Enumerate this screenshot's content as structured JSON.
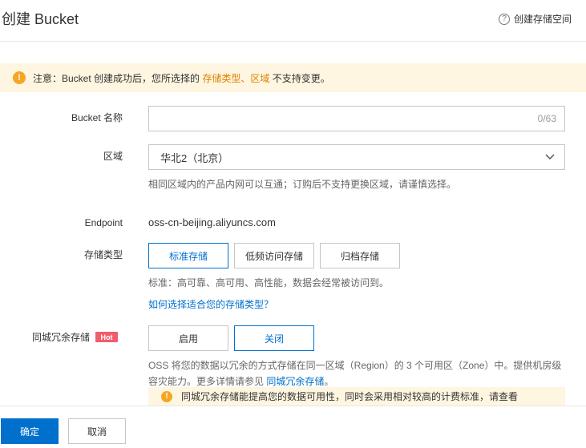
{
  "header": {
    "title": "创建 Bucket",
    "help_icon_glyph": "?",
    "help_label": "创建存储空间"
  },
  "notice": {
    "icon_glyph": "!",
    "prefix": "注意：Bucket 创建成功后，您所选择的 ",
    "highlight": "存储类型、区域",
    "suffix": " 不支持变更。"
  },
  "bucket_name": {
    "label": "Bucket 名称",
    "value": "",
    "counter": "0/63"
  },
  "region": {
    "label": "区域",
    "selected": "华北2（北京）",
    "hint": "相同区域内的产品内网可以互通；订购后不支持更换区域，请谨慎选择。"
  },
  "endpoint": {
    "label": "Endpoint",
    "value": "oss-cn-beijing.aliyuncs.com"
  },
  "storage_class": {
    "label": "存储类型",
    "options": [
      "标准存储",
      "低频访问存储",
      "归档存储"
    ],
    "selected_index": 0,
    "hint": "标准：高可靠、高可用、高性能，数据会经常被访问到。",
    "help_link": "如何选择适合您的存储类型？"
  },
  "zone_redundancy": {
    "label": "同城冗余存储",
    "badge": "Hot",
    "options": [
      "启用",
      "关闭"
    ],
    "selected_index": 1,
    "desc_line1": "OSS 将您的数据以冗余的方式存储在同一区域（Region）的 3 个可用区（Zone）中。提供机房级",
    "desc_line2_prefix": "容灾能力。更多详情请参见 ",
    "desc_link": "同城冗余存储",
    "desc_line2_suffix": "。",
    "notice_icon_glyph": "!",
    "notice_text": "同城冗余存储能提高您的数据可用性，同时会采用相对较高的计费标准，请查看"
  },
  "footer": {
    "confirm_label": "确定",
    "cancel_label": "取消"
  },
  "colors": {
    "primary": "#0070cc",
    "notice_bg": "#fff6e1",
    "warning": "#f5a623",
    "highlight": "#e08200",
    "hot_badge": "#f15d6d"
  },
  "icons": {
    "help": "help-circle-icon",
    "warning": "warning-icon",
    "chevron": "chevron-down-icon"
  }
}
